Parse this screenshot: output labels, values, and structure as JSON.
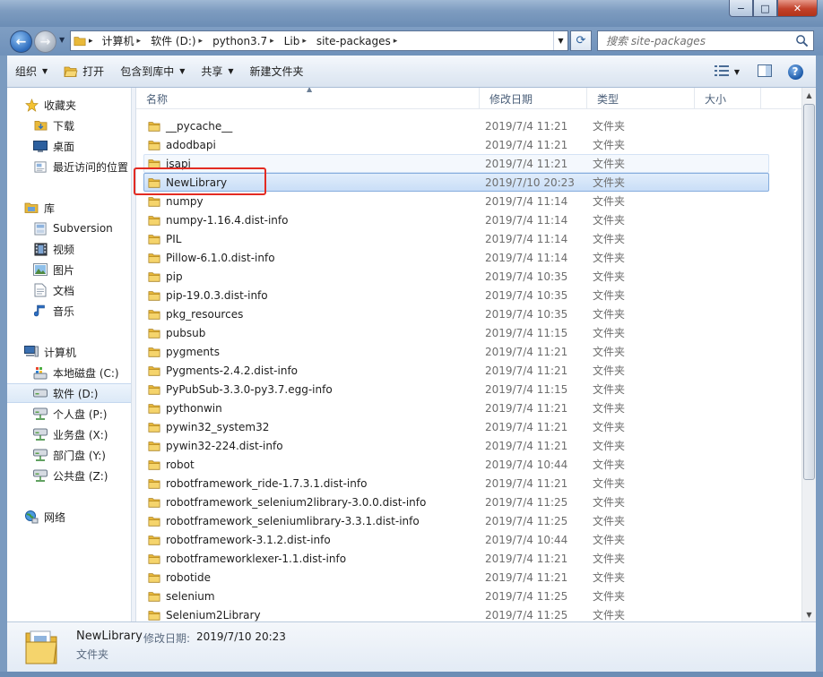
{
  "window": {
    "minimize": "−",
    "maximize": "□",
    "close": "✕"
  },
  "address": {
    "crumbs": [
      "计算机",
      "软件 (D:)",
      "python3.7",
      "Lib",
      "site-packages"
    ]
  },
  "search": {
    "placeholder": "搜索 site-packages"
  },
  "toolbar": {
    "organize": "组织",
    "open": "打开",
    "include_in_library": "包含到库中",
    "share": "共享",
    "new_folder": "新建文件夹"
  },
  "sidebar": {
    "favorites": {
      "label": "收藏夹",
      "items": [
        "下载",
        "桌面",
        "最近访问的位置"
      ]
    },
    "libraries": {
      "label": "库",
      "items": [
        "Subversion",
        "视频",
        "图片",
        "文档",
        "音乐"
      ]
    },
    "computer": {
      "label": "计算机",
      "items": [
        "本地磁盘 (C:)",
        "软件 (D:)",
        "个人盘 (P:)",
        "业务盘 (X:)",
        "部门盘 (Y:)",
        "公共盘 (Z:)"
      ]
    },
    "network": {
      "label": "网络"
    }
  },
  "columns": {
    "name": "名称",
    "modified": "修改日期",
    "type": "类型",
    "size": "大小"
  },
  "files": [
    {
      "name": "__pycache__",
      "date": "2019/7/4 11:21",
      "type": "文件夹"
    },
    {
      "name": "adodbapi",
      "date": "2019/7/4 11:21",
      "type": "文件夹"
    },
    {
      "name": "isapi",
      "date": "2019/7/4 11:21",
      "type": "文件夹"
    },
    {
      "name": "NewLibrary",
      "date": "2019/7/10 20:23",
      "type": "文件夹"
    },
    {
      "name": "numpy",
      "date": "2019/7/4 11:14",
      "type": "文件夹"
    },
    {
      "name": "numpy-1.16.4.dist-info",
      "date": "2019/7/4 11:14",
      "type": "文件夹"
    },
    {
      "name": "PIL",
      "date": "2019/7/4 11:14",
      "type": "文件夹"
    },
    {
      "name": "Pillow-6.1.0.dist-info",
      "date": "2019/7/4 11:14",
      "type": "文件夹"
    },
    {
      "name": "pip",
      "date": "2019/7/4 10:35",
      "type": "文件夹"
    },
    {
      "name": "pip-19.0.3.dist-info",
      "date": "2019/7/4 10:35",
      "type": "文件夹"
    },
    {
      "name": "pkg_resources",
      "date": "2019/7/4 10:35",
      "type": "文件夹"
    },
    {
      "name": "pubsub",
      "date": "2019/7/4 11:15",
      "type": "文件夹"
    },
    {
      "name": "pygments",
      "date": "2019/7/4 11:21",
      "type": "文件夹"
    },
    {
      "name": "Pygments-2.4.2.dist-info",
      "date": "2019/7/4 11:21",
      "type": "文件夹"
    },
    {
      "name": "PyPubSub-3.3.0-py3.7.egg-info",
      "date": "2019/7/4 11:15",
      "type": "文件夹"
    },
    {
      "name": "pythonwin",
      "date": "2019/7/4 11:21",
      "type": "文件夹"
    },
    {
      "name": "pywin32_system32",
      "date": "2019/7/4 11:21",
      "type": "文件夹"
    },
    {
      "name": "pywin32-224.dist-info",
      "date": "2019/7/4 11:21",
      "type": "文件夹"
    },
    {
      "name": "robot",
      "date": "2019/7/4 10:44",
      "type": "文件夹"
    },
    {
      "name": "robotframework_ride-1.7.3.1.dist-info",
      "date": "2019/7/4 11:21",
      "type": "文件夹"
    },
    {
      "name": "robotframework_selenium2library-3.0.0.dist-info",
      "date": "2019/7/4 11:25",
      "type": "文件夹"
    },
    {
      "name": "robotframework_seleniumlibrary-3.3.1.dist-info",
      "date": "2019/7/4 11:25",
      "type": "文件夹"
    },
    {
      "name": "robotframework-3.1.2.dist-info",
      "date": "2019/7/4 10:44",
      "type": "文件夹"
    },
    {
      "name": "robotframeworklexer-1.1.dist-info",
      "date": "2019/7/4 11:21",
      "type": "文件夹"
    },
    {
      "name": "robotide",
      "date": "2019/7/4 11:21",
      "type": "文件夹"
    },
    {
      "name": "selenium",
      "date": "2019/7/4 11:25",
      "type": "文件夹"
    },
    {
      "name": "Selenium2Library",
      "date": "2019/7/4 11:25",
      "type": "文件夹"
    }
  ],
  "selected_index": 3,
  "hover_index": 2,
  "details": {
    "name": "NewLibrary",
    "modified_label": "修改日期:",
    "modified_value": "2019/7/10 20:23",
    "type": "文件夹"
  },
  "colors": {
    "selection_bg": "#cfe2f8",
    "selection_border": "#84acdd",
    "annotation_red": "#e32b22",
    "folder_yellow": "#f2c94c"
  }
}
